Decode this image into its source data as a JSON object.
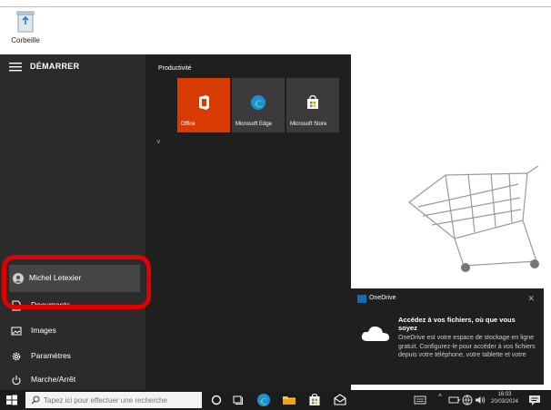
{
  "desktop": {
    "trash_label": "Corbeille"
  },
  "start_menu": {
    "title": "DÉMARRER",
    "group_label": "Productivité",
    "tiles": [
      {
        "label": "Office",
        "color": "#d83b01"
      },
      {
        "label": "Microsoft Edge",
        "color": "#3b3b3b"
      },
      {
        "label": "Microsoft Store",
        "color": "#3b3b3b"
      }
    ],
    "rail": {
      "user": "Michel Letexier",
      "documents": "Documents",
      "images": "Images",
      "settings": "Paramètres",
      "power": "Marche/Arrêt"
    }
  },
  "toast": {
    "app_name": "OneDrive",
    "headline": "Accédez à vos fichiers, où que vous soyez",
    "body": "OneDrive est votre espace de stockage en ligne gratuit. Configurez-le pour accéder à vos fichiers depuis votre téléphone, votre tablette et votre"
  },
  "taskbar": {
    "search_placeholder": "Tapez ici pour effectuer une recherche",
    "time": "16:03",
    "date": "20/03/2024"
  },
  "colors": {
    "highlight": "#e00000",
    "office_tile": "#d83b01",
    "start_bg": "#2b2b2b"
  }
}
